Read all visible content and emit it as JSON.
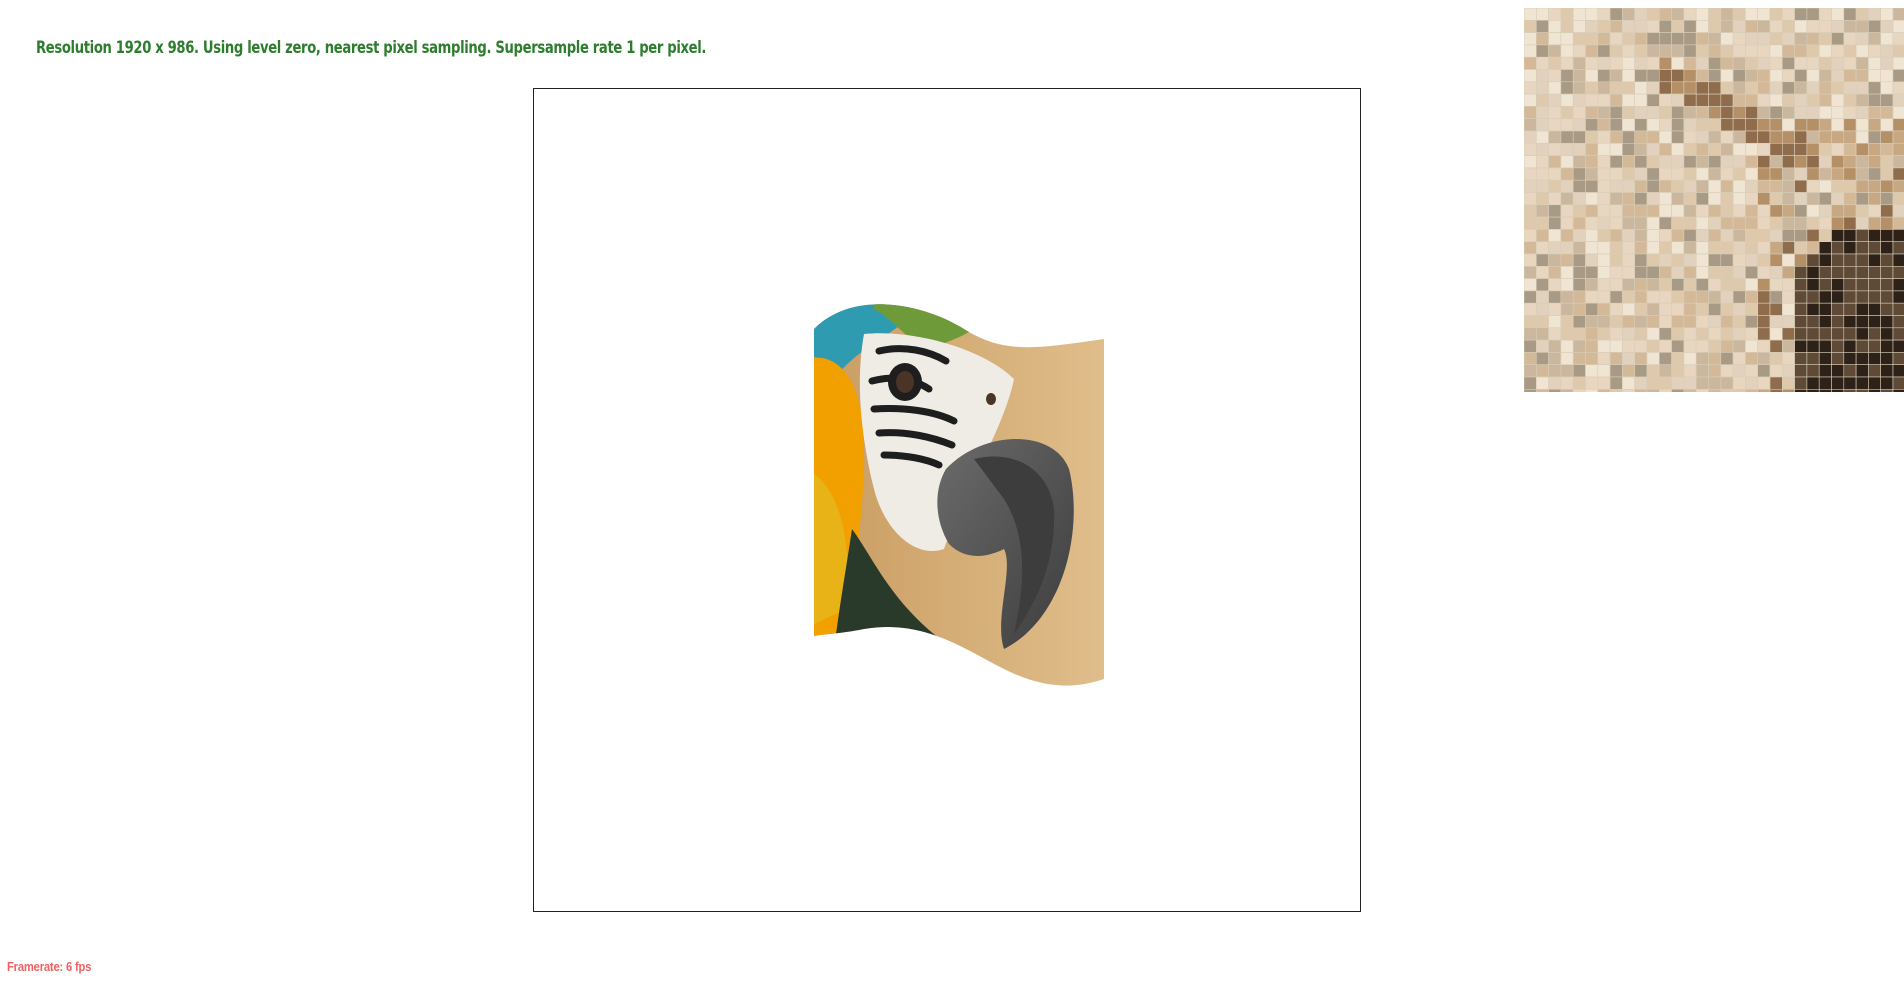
{
  "status": {
    "text": "Resolution 1920 x 986. Using level zero, nearest pixel sampling. Supersample rate 1 per pixel.",
    "color": "#2e7d2e"
  },
  "framerate": {
    "text": "Framerate: 6 fps",
    "color": "#f06060"
  },
  "texture": {
    "subject": "macaw-parrot-head",
    "palette": {
      "background": "#c89a5e",
      "background_light": "#e1c08e",
      "crest_teal": "#2e9bb0",
      "crest_green": "#6f9a3a",
      "orange_feathers": "#f2a000",
      "yellow_feathers": "#e8b317",
      "white_face": "#efece6",
      "stripe_black": "#1e1e1e",
      "beak_dark": "#3d3d3d",
      "beak_mid": "#6b6b6b",
      "eye": "#4a3426",
      "dark_feathers": "#2a3a2a"
    }
  },
  "zoom": {
    "grid_line_color": "#d8cdb8",
    "tones": [
      "#e8d6c0",
      "#dfc9ac",
      "#d4b998",
      "#c7a882",
      "#b59066",
      "#8f6d4c",
      "#5e4a36",
      "#2e2218",
      "#a89a85",
      "#e2d2bd",
      "#cbb79d",
      "#f0e4d2"
    ]
  }
}
